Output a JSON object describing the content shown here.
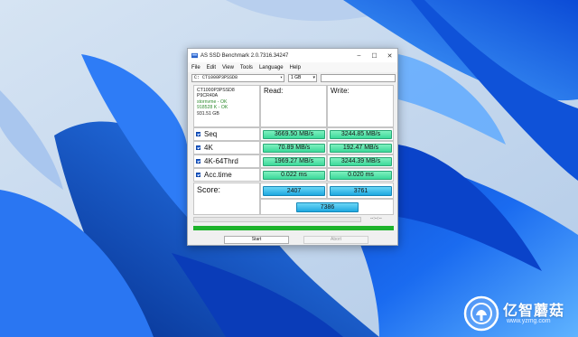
{
  "window": {
    "title": "AS SSD Benchmark 2.0.7316.34247",
    "controls": {
      "minimize": "–",
      "maximize": "☐",
      "close": "✕"
    }
  },
  "menu": [
    "File",
    "Edit",
    "View",
    "Tools",
    "Language",
    "Help"
  ],
  "toolbar": {
    "drive": "C: CT1000P3PSSD8",
    "size": "1 GB"
  },
  "drive_info": {
    "model": "CT1000P3PSSD8",
    "firmware": "P9CR40A",
    "driver": "stornvme - OK",
    "alignment": "918528 K - OK",
    "capacity": "931.51 GB"
  },
  "columns": {
    "read": "Read:",
    "write": "Write:"
  },
  "tests": [
    {
      "label": "Seq",
      "read": "3669.50 MB/s",
      "write": "3244.85 MB/s"
    },
    {
      "label": "4K",
      "read": "70.89 MB/s",
      "write": "192.47 MB/s"
    },
    {
      "label": "4K-64Thrd",
      "read": "1969.27 MB/s",
      "write": "3244.39 MB/s"
    },
    {
      "label": "Acc.time",
      "read": "0.022 ms",
      "write": "0.020 ms"
    }
  ],
  "score": {
    "label": "Score:",
    "read": "2407",
    "write": "3761",
    "total": "7386"
  },
  "progress": {
    "time": "--:--:--",
    "value": 1.0,
    "color": "#1db32b"
  },
  "buttons": {
    "start": "Start",
    "abort": "Abort"
  },
  "watermark": {
    "brand": "亿智蘑菇",
    "url": "www.yzmg.com"
  }
}
